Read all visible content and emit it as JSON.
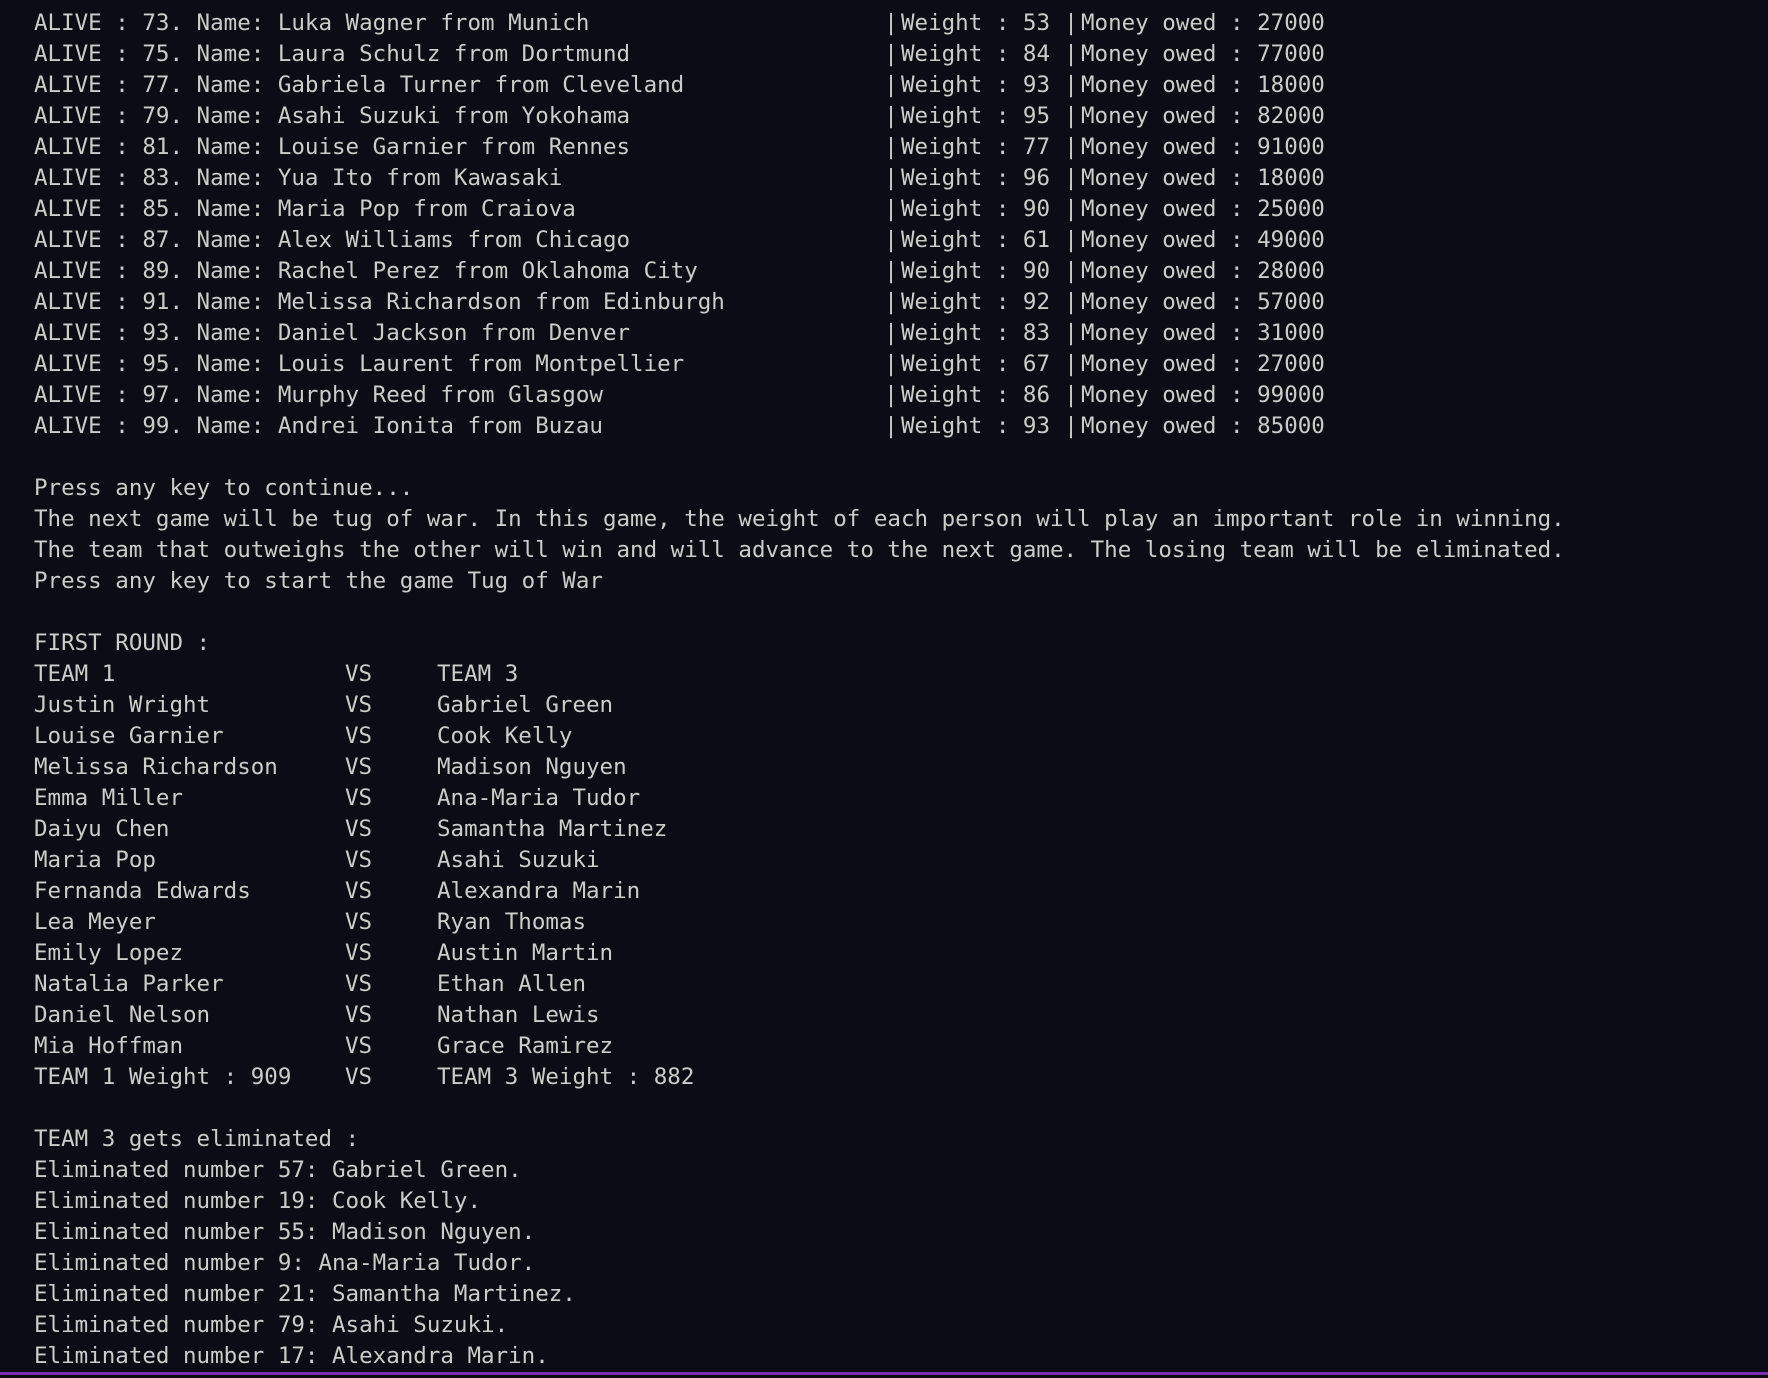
{
  "alive_rows": [
    {
      "status": "ALIVE",
      "text": "ALIVE : 73. Name: Luka Wagner from Munich",
      "weight": "Weight : 53",
      "money": "Money owed : 27000"
    },
    {
      "status": "ALIVE",
      "text": "ALIVE : 75. Name: Laura Schulz from Dortmund",
      "weight": "Weight : 84",
      "money": "Money owed : 77000"
    },
    {
      "status": "ALIVE",
      "text": "ALIVE : 77. Name: Gabriela Turner from Cleveland",
      "weight": "Weight : 93",
      "money": "Money owed : 18000"
    },
    {
      "status": "ALIVE",
      "text": "ALIVE : 79. Name: Asahi Suzuki from Yokohama",
      "weight": "Weight : 95",
      "money": "Money owed : 82000"
    },
    {
      "status": "ALIVE",
      "text": "ALIVE : 81. Name: Louise Garnier from Rennes",
      "weight": "Weight : 77",
      "money": "Money owed : 91000"
    },
    {
      "status": "ALIVE",
      "text": "ALIVE : 83. Name: Yua Ito from Kawasaki",
      "weight": "Weight : 96",
      "money": "Money owed : 18000"
    },
    {
      "status": "ALIVE",
      "text": "ALIVE : 85. Name: Maria Pop from Craiova",
      "weight": "Weight : 90",
      "money": "Money owed : 25000"
    },
    {
      "status": "ALIVE",
      "text": "ALIVE : 87. Name: Alex Williams from Chicago",
      "weight": "Weight : 61",
      "money": "Money owed : 49000"
    },
    {
      "status": "ALIVE",
      "text": "ALIVE : 89. Name: Rachel Perez from Oklahoma City",
      "weight": "Weight : 90",
      "money": "Money owed : 28000"
    },
    {
      "status": "ALIVE",
      "text": "ALIVE : 91. Name: Melissa Richardson from Edinburgh",
      "weight": "Weight : 92",
      "money": "Money owed : 57000"
    },
    {
      "status": "ALIVE",
      "text": "ALIVE : 93. Name: Daniel Jackson from Denver",
      "weight": "Weight : 83",
      "money": "Money owed : 31000"
    },
    {
      "status": "ALIVE",
      "text": "ALIVE : 95. Name: Louis Laurent from Montpellier",
      "weight": "Weight : 67",
      "money": "Money owed : 27000"
    },
    {
      "status": "ALIVE",
      "text": "ALIVE : 97. Name: Murphy Reed from Glasgow",
      "weight": "Weight : 86",
      "money": "Money owed : 99000"
    },
    {
      "status": "ALIVE",
      "text": "ALIVE : 99. Name: Andrei Ionita from Buzau",
      "weight": "Weight : 93",
      "money": "Money owed : 85000"
    }
  ],
  "separator": "|",
  "messages": [
    "Press any key to continue...",
    "The next game will be tug of war. In this game, the weight of each person will play an important role in winning.",
    "The team that outweighs the other will win and will advance to the next game. The losing team will be eliminated.",
    "Press any key to start the game Tug of War"
  ],
  "round_title": "FIRST ROUND :",
  "vs_label": "VS",
  "matchups": [
    {
      "left": "TEAM 1",
      "right": "TEAM 3"
    },
    {
      "left": "Justin Wright",
      "right": "Gabriel Green"
    },
    {
      "left": "Louise Garnier",
      "right": "Cook Kelly"
    },
    {
      "left": "Melissa Richardson",
      "right": "Madison Nguyen"
    },
    {
      "left": "Emma Miller",
      "right": "Ana-Maria Tudor"
    },
    {
      "left": "Daiyu Chen",
      "right": "Samantha Martinez"
    },
    {
      "left": "Maria Pop",
      "right": "Asahi Suzuki"
    },
    {
      "left": "Fernanda Edwards",
      "right": "Alexandra Marin"
    },
    {
      "left": "Lea Meyer",
      "right": "Ryan Thomas"
    },
    {
      "left": "Emily Lopez",
      "right": "Austin Martin"
    },
    {
      "left": "Natalia Parker",
      "right": "Ethan Allen"
    },
    {
      "left": "Daniel Nelson",
      "right": "Nathan Lewis"
    },
    {
      "left": "Mia Hoffman",
      "right": "Grace Ramirez"
    },
    {
      "left": "TEAM 1 Weight : 909",
      "right": "TEAM 3 Weight : 882"
    }
  ],
  "elimination_title": "TEAM 3 gets eliminated :",
  "eliminated": [
    "Eliminated number 57: Gabriel Green.",
    "Eliminated number 19: Cook Kelly.",
    "Eliminated number 55: Madison Nguyen.",
    "Eliminated number 9: Ana-Maria Tudor.",
    "Eliminated number 21: Samantha Martinez.",
    "Eliminated number 79: Asahi Suzuki.",
    "Eliminated number 17: Alexandra Marin."
  ],
  "colors": {
    "background": "#0c0c14",
    "text": "#cccccc",
    "accent_border": "#7b2fb8"
  }
}
